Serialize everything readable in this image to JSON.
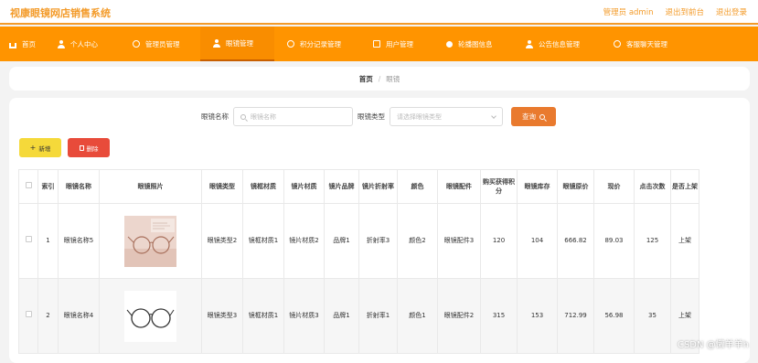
{
  "brand": "视康眼镜网店销售系统",
  "top_links": [
    "管理员 admin",
    "退出到前台",
    "退出登录"
  ],
  "nav": [
    {
      "label": "首页",
      "icon": "home-icon",
      "active": false
    },
    {
      "label": "个人中心",
      "icon": "person-icon",
      "active": false
    },
    {
      "label": "管理员管理",
      "icon": "ring-icon",
      "active": false
    },
    {
      "label": "眼镜管理",
      "icon": "person-icon",
      "active": true
    },
    {
      "label": "积分记录管理",
      "icon": "ring-icon",
      "active": false
    },
    {
      "label": "用户管理",
      "icon": "square-icon",
      "active": false
    },
    {
      "label": "轮播图信息",
      "icon": "dot-icon",
      "active": false
    },
    {
      "label": "公告信息管理",
      "icon": "person-icon",
      "active": false
    },
    {
      "label": "客服聊天管理",
      "icon": "ring-icon",
      "active": false
    }
  ],
  "breadcrumb": {
    "home": "首页",
    "separator": "/",
    "current": "眼镜"
  },
  "search": {
    "name_label": "眼镜名称",
    "name_placeholder": "眼镜名称",
    "type_label": "眼镜类型",
    "type_placeholder": "请选择眼镜类型",
    "query_label": "查询"
  },
  "actions": {
    "add_label": "新增",
    "delete_label": "删除"
  },
  "table": {
    "headers": [
      "索引",
      "眼镜名称",
      "眼镜照片",
      "眼镜类型",
      "镜框材质",
      "镜片材质",
      "镜片品牌",
      "镜片折射率",
      "颜色",
      "眼镜配件",
      "购买获得积分",
      "眼镜库存",
      "眼镜原价",
      "现价",
      "点击次数",
      "是否上架"
    ],
    "rows": [
      {
        "index": "1",
        "name": "眼镜名称5",
        "photo": "rose-gold-round-glasses",
        "type": "眼镜类型2",
        "frame": "镜框材质1",
        "lens": "镜片材质2",
        "brand": "品牌1",
        "refraction": "折射率3",
        "color": "颜色2",
        "accessory": "眼镜配件3",
        "points": "120",
        "stock": "104",
        "orig_price": "666.82",
        "price": "89.03",
        "clicks": "125",
        "listed": "上架"
      },
      {
        "index": "2",
        "name": "眼镜名称4",
        "photo": "black-metal-round-glasses",
        "type": "眼镜类型3",
        "frame": "镜框材质1",
        "lens": "镜片材质3",
        "brand": "品牌1",
        "refraction": "折射率1",
        "color": "颜色1",
        "accessory": "眼镜配件2",
        "points": "315",
        "stock": "153",
        "orig_price": "712.99",
        "price": "56.98",
        "clicks": "35",
        "listed": "上架"
      }
    ]
  },
  "colors": {
    "accent": "#ff9400",
    "brand_text": "#f39b2a",
    "query_button": "#e97a2e",
    "add_button": "#f5d93a",
    "delete_button": "#e84b3a"
  },
  "watermark": "CSDN @懒羊羊h"
}
